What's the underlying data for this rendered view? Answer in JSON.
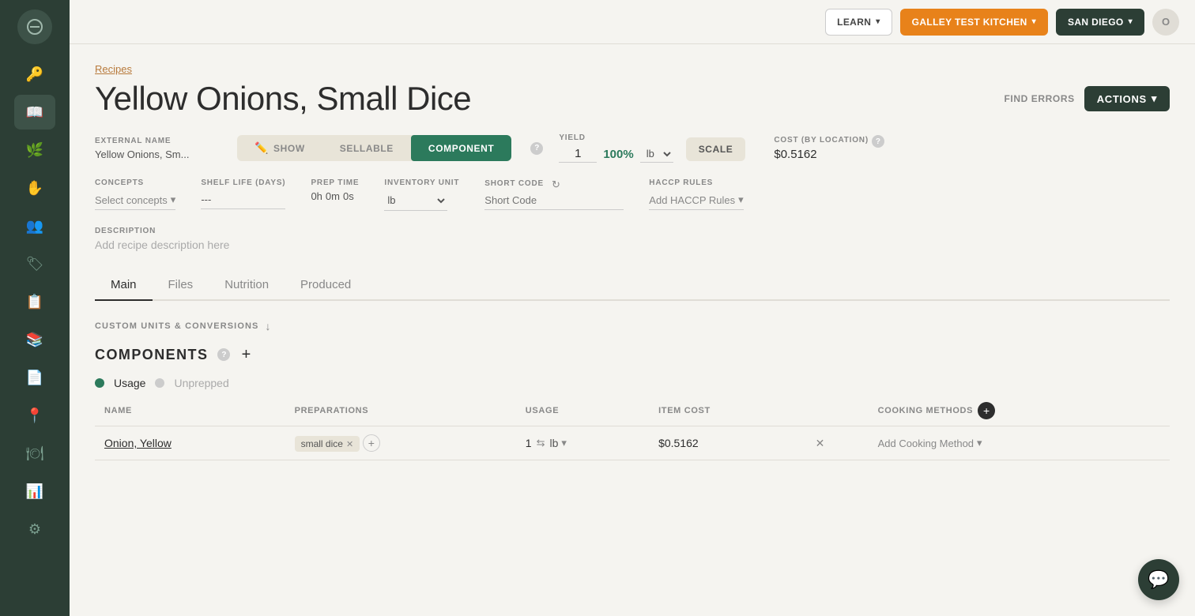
{
  "nav": {
    "learn_label": "LEARN",
    "kitchen_label": "GALLEY TEST KITCHEN",
    "location_label": "SAN DIEGO",
    "find_errors_label": "FIND ERRORS",
    "actions_label": "ACTIONS"
  },
  "sidebar": {
    "items": [
      {
        "name": "key-icon",
        "icon": "🔑",
        "active": false
      },
      {
        "name": "book-icon",
        "icon": "📖",
        "active": true
      },
      {
        "name": "leaf-icon",
        "icon": "🌿",
        "active": false
      },
      {
        "name": "hand-icon",
        "icon": "✋",
        "active": false
      },
      {
        "name": "people-icon",
        "icon": "👥",
        "active": false
      },
      {
        "name": "tag-icon",
        "icon": "🏷",
        "active": false
      },
      {
        "name": "list-icon",
        "icon": "📋",
        "active": false
      },
      {
        "name": "library-icon",
        "icon": "📚",
        "active": false
      },
      {
        "name": "report-icon",
        "icon": "📄",
        "active": false
      },
      {
        "name": "location-icon",
        "icon": "📍",
        "active": false
      },
      {
        "name": "events-icon",
        "icon": "🍽",
        "active": false
      },
      {
        "name": "chart-icon",
        "icon": "📊",
        "active": false
      },
      {
        "name": "settings-icon",
        "icon": "⚙",
        "active": false
      }
    ]
  },
  "breadcrumb": "Recipes",
  "page_title": "Yellow Onions, Small Dice",
  "external_name": {
    "label": "EXTERNAL NAME",
    "value": "Yellow Onions, Sm..."
  },
  "type_options": {
    "show_label": "SHOW",
    "sellable_label": "SELLABLE",
    "component_label": "COMPONENT"
  },
  "yield_section": {
    "label": "YIELD",
    "value": "1",
    "percentage": "100%",
    "unit": "lb"
  },
  "scale_label": "SCALE",
  "cost_section": {
    "label": "COST (BY LOCATION)",
    "value": "$0.5162"
  },
  "concepts": {
    "label": "CONCEPTS",
    "placeholder": "Select concepts"
  },
  "shelf_life": {
    "label": "SHELF LIFE (DAYS)",
    "value": "---"
  },
  "prep_time": {
    "label": "PREP TIME",
    "hours": "0h",
    "minutes": "0m",
    "seconds": "0s"
  },
  "inventory_unit": {
    "label": "INVENTORY UNIT",
    "value": "lb"
  },
  "short_code": {
    "label": "SHORT CODE",
    "placeholder": "Short Code"
  },
  "haccp_rules": {
    "label": "HACCP RULES",
    "placeholder": "Add HACCP Rules"
  },
  "description": {
    "label": "DESCRIPTION",
    "placeholder": "Add recipe description here"
  },
  "tabs": [
    "Main",
    "Files",
    "Nutrition",
    "Produced"
  ],
  "active_tab": "Main",
  "custom_units_label": "CUSTOM UNITS & CONVERSIONS",
  "components": {
    "label": "COMPONENTS",
    "usage_row": {
      "active_label": "Usage",
      "inactive_label": "Unprepped"
    },
    "table": {
      "columns": [
        "Name",
        "Preparations",
        "Usage",
        "Item Cost",
        "",
        "Cooking Methods"
      ],
      "rows": [
        {
          "name": "Onion, Yellow",
          "preparation": "small dice",
          "usage_qty": "1",
          "usage_unit": "lb",
          "item_cost": "$0.5162",
          "cooking_method_placeholder": "Add Cooking Method"
        }
      ]
    }
  }
}
